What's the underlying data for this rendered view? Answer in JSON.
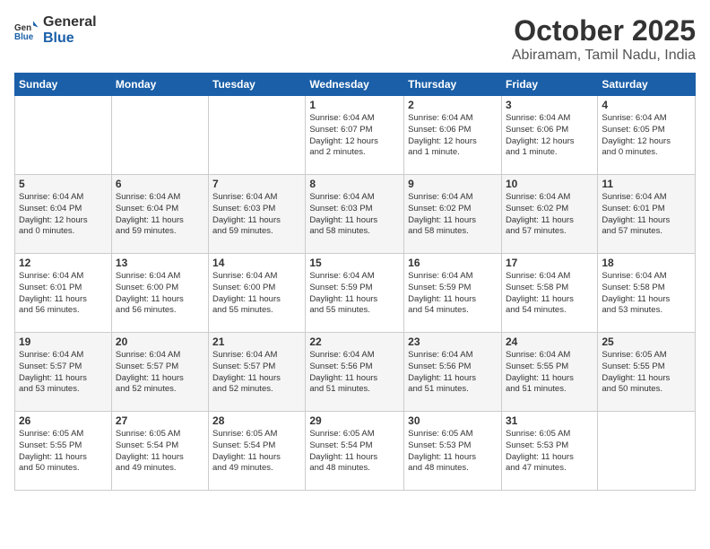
{
  "header": {
    "logo_line1": "General",
    "logo_line2": "Blue",
    "month": "October 2025",
    "location": "Abiramam, Tamil Nadu, India"
  },
  "days_of_week": [
    "Sunday",
    "Monday",
    "Tuesday",
    "Wednesday",
    "Thursday",
    "Friday",
    "Saturday"
  ],
  "weeks": [
    [
      {
        "day": "",
        "info": ""
      },
      {
        "day": "",
        "info": ""
      },
      {
        "day": "",
        "info": ""
      },
      {
        "day": "1",
        "info": "Sunrise: 6:04 AM\nSunset: 6:07 PM\nDaylight: 12 hours\nand 2 minutes."
      },
      {
        "day": "2",
        "info": "Sunrise: 6:04 AM\nSunset: 6:06 PM\nDaylight: 12 hours\nand 1 minute."
      },
      {
        "day": "3",
        "info": "Sunrise: 6:04 AM\nSunset: 6:06 PM\nDaylight: 12 hours\nand 1 minute."
      },
      {
        "day": "4",
        "info": "Sunrise: 6:04 AM\nSunset: 6:05 PM\nDaylight: 12 hours\nand 0 minutes."
      }
    ],
    [
      {
        "day": "5",
        "info": "Sunrise: 6:04 AM\nSunset: 6:04 PM\nDaylight: 12 hours\nand 0 minutes."
      },
      {
        "day": "6",
        "info": "Sunrise: 6:04 AM\nSunset: 6:04 PM\nDaylight: 11 hours\nand 59 minutes."
      },
      {
        "day": "7",
        "info": "Sunrise: 6:04 AM\nSunset: 6:03 PM\nDaylight: 11 hours\nand 59 minutes."
      },
      {
        "day": "8",
        "info": "Sunrise: 6:04 AM\nSunset: 6:03 PM\nDaylight: 11 hours\nand 58 minutes."
      },
      {
        "day": "9",
        "info": "Sunrise: 6:04 AM\nSunset: 6:02 PM\nDaylight: 11 hours\nand 58 minutes."
      },
      {
        "day": "10",
        "info": "Sunrise: 6:04 AM\nSunset: 6:02 PM\nDaylight: 11 hours\nand 57 minutes."
      },
      {
        "day": "11",
        "info": "Sunrise: 6:04 AM\nSunset: 6:01 PM\nDaylight: 11 hours\nand 57 minutes."
      }
    ],
    [
      {
        "day": "12",
        "info": "Sunrise: 6:04 AM\nSunset: 6:01 PM\nDaylight: 11 hours\nand 56 minutes."
      },
      {
        "day": "13",
        "info": "Sunrise: 6:04 AM\nSunset: 6:00 PM\nDaylight: 11 hours\nand 56 minutes."
      },
      {
        "day": "14",
        "info": "Sunrise: 6:04 AM\nSunset: 6:00 PM\nDaylight: 11 hours\nand 55 minutes."
      },
      {
        "day": "15",
        "info": "Sunrise: 6:04 AM\nSunset: 5:59 PM\nDaylight: 11 hours\nand 55 minutes."
      },
      {
        "day": "16",
        "info": "Sunrise: 6:04 AM\nSunset: 5:59 PM\nDaylight: 11 hours\nand 54 minutes."
      },
      {
        "day": "17",
        "info": "Sunrise: 6:04 AM\nSunset: 5:58 PM\nDaylight: 11 hours\nand 54 minutes."
      },
      {
        "day": "18",
        "info": "Sunrise: 6:04 AM\nSunset: 5:58 PM\nDaylight: 11 hours\nand 53 minutes."
      }
    ],
    [
      {
        "day": "19",
        "info": "Sunrise: 6:04 AM\nSunset: 5:57 PM\nDaylight: 11 hours\nand 53 minutes."
      },
      {
        "day": "20",
        "info": "Sunrise: 6:04 AM\nSunset: 5:57 PM\nDaylight: 11 hours\nand 52 minutes."
      },
      {
        "day": "21",
        "info": "Sunrise: 6:04 AM\nSunset: 5:57 PM\nDaylight: 11 hours\nand 52 minutes."
      },
      {
        "day": "22",
        "info": "Sunrise: 6:04 AM\nSunset: 5:56 PM\nDaylight: 11 hours\nand 51 minutes."
      },
      {
        "day": "23",
        "info": "Sunrise: 6:04 AM\nSunset: 5:56 PM\nDaylight: 11 hours\nand 51 minutes."
      },
      {
        "day": "24",
        "info": "Sunrise: 6:04 AM\nSunset: 5:55 PM\nDaylight: 11 hours\nand 51 minutes."
      },
      {
        "day": "25",
        "info": "Sunrise: 6:05 AM\nSunset: 5:55 PM\nDaylight: 11 hours\nand 50 minutes."
      }
    ],
    [
      {
        "day": "26",
        "info": "Sunrise: 6:05 AM\nSunset: 5:55 PM\nDaylight: 11 hours\nand 50 minutes."
      },
      {
        "day": "27",
        "info": "Sunrise: 6:05 AM\nSunset: 5:54 PM\nDaylight: 11 hours\nand 49 minutes."
      },
      {
        "day": "28",
        "info": "Sunrise: 6:05 AM\nSunset: 5:54 PM\nDaylight: 11 hours\nand 49 minutes."
      },
      {
        "day": "29",
        "info": "Sunrise: 6:05 AM\nSunset: 5:54 PM\nDaylight: 11 hours\nand 48 minutes."
      },
      {
        "day": "30",
        "info": "Sunrise: 6:05 AM\nSunset: 5:53 PM\nDaylight: 11 hours\nand 48 minutes."
      },
      {
        "day": "31",
        "info": "Sunrise: 6:05 AM\nSunset: 5:53 PM\nDaylight: 11 hours\nand 47 minutes."
      },
      {
        "day": "",
        "info": ""
      }
    ]
  ]
}
